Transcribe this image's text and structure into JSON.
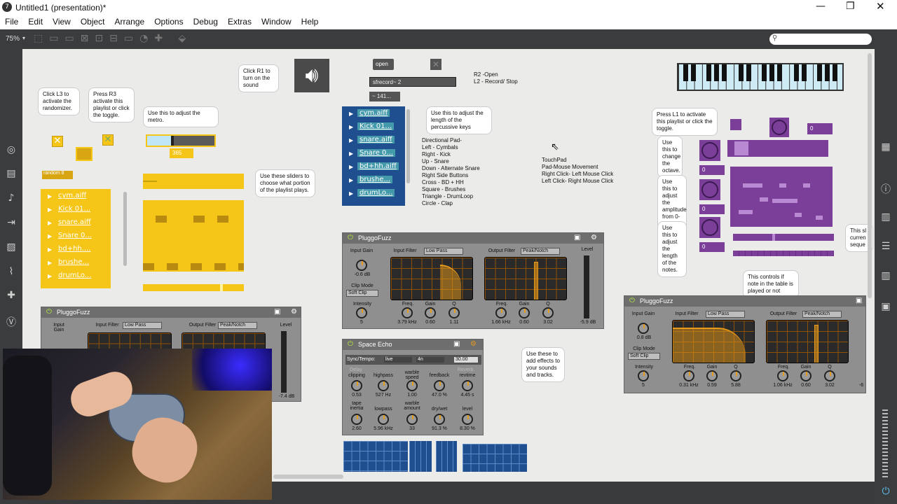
{
  "window": {
    "title": "Untitled1 (presentation)*"
  },
  "menu": [
    "File",
    "Edit",
    "View",
    "Object",
    "Arrange",
    "Options",
    "Debug",
    "Extras",
    "Window",
    "Help"
  ],
  "toolbar": {
    "zoom": "75%"
  },
  "bubbles": {
    "l3": "Click L3 to activate the randomizer.",
    "r3": "Press R3 activate this playlist or click the toggle.",
    "metro": "Use this to adjust the metro.",
    "r1": "Click R1 to turn on the sound",
    "sliders": "Use these sliders to choose what portion of the playlist plays.",
    "length": "Use this to adjust the length of the percussive keys",
    "l1": "Press L1 to activate this playlist or click the toggle.",
    "octave": "Use this to change the octave.",
    "amp": "Use this to adjust the amplitude from 0-127.",
    "notelen": "Use this to adjust the length of the notes.",
    "controls": "This controls if note in the table is played or not",
    "effects": "Use these to add effects to your sounds and tracks.",
    "right_cut": "This sl curren seque"
  },
  "buttons": {
    "open": "open",
    "random": "random 8"
  },
  "numbers": {
    "metro": "365",
    "tempo": "~ 141...",
    "purple1": "0",
    "purple2": "0",
    "purple3": "0",
    "purple4": "0"
  },
  "sfrecord": "sfrecord~ 2",
  "recinfo": [
    "R2 -Open",
    "L2 - Record/ Stop"
  ],
  "dpad": [
    "Directional Pad-",
    "Left - Cymbals",
    "Right - Kick",
    "Up - Snare",
    "Down - Alternate Snare",
    "",
    "Right Side Buttons",
    "Cross - BD + HH",
    "Square - Brushes",
    "Triangle - DrumLoop",
    "Circle - Clap"
  ],
  "touchpad": [
    "TouchPad",
    "Pad-Mouse Movement",
    "Right Click- Left Mouse Click",
    "Left Click- Right Mouse Click"
  ],
  "playlist_left": [
    "cym.aiff",
    "Kick 01...",
    "snare.aiff",
    "Snare 0...",
    "bd+hh....",
    "brushe...",
    "drumLo..."
  ],
  "playlist_mid": [
    "cym.aiff",
    "Kick 01...",
    "snare.aiff",
    "Snare 0...",
    "bd+hh.aiff",
    "brushe...",
    "drumLo..."
  ],
  "fuzz_mid": {
    "title": "PluggoFuzz",
    "input_gain_label": "Input Gain",
    "input_gain": "-0.6 dB",
    "clip_mode_label": "Clip Mode",
    "clip_mode": "Soft Clip",
    "intensity_label": "Intensity",
    "intensity": "5",
    "input_filter_label": "Input Filter",
    "input_filter": "Low Pass",
    "output_filter_label": "Output Filter",
    "output_filter": "Peak/Notch",
    "level_label": "Level",
    "level": "-5.9 dB",
    "freq_label": "Freq.",
    "gain_label": "Gain",
    "q_label": "Q",
    "in_freq": "3.79 kHz",
    "in_gain": "0.60",
    "in_q": "1.11",
    "out_freq": "1.66 kHz",
    "out_gain": "0.60",
    "out_q": "3.02"
  },
  "fuzz_left": {
    "title": "PluggoFuzz",
    "input_gain_label": "Input Gain",
    "input_filter_label": "Input Filter",
    "input_filter": "Low Pass",
    "output_filter_label": "Output Filter",
    "output_filter": "Peak/Notch",
    "level_label": "Level",
    "level": "-7.4 dB"
  },
  "fuzz_right": {
    "title": "PluggoFuzz",
    "input_gain_label": "Input Gain",
    "input_gain": "0.8 dB",
    "clip_mode_label": "Clip Mode",
    "clip_mode": "Soft Clip",
    "intensity_label": "Intensity",
    "intensity": "5",
    "input_filter_label": "Input Filter",
    "input_filter": "Low Pass",
    "output_filter_label": "Output Filter",
    "output_filter": "Peak/Notch",
    "freq_label": "Freq.",
    "gain_label": "Gain",
    "q_label": "Q",
    "in_freq": "0.31 kHz",
    "in_gain": "0.59",
    "in_q": "5.88",
    "out_freq": "1.06 kHz",
    "out_gain": "0.60",
    "out_q": "3.02",
    "cut": "-6"
  },
  "echo": {
    "title": "Space Echo",
    "sync_label": "Sync/Tempo:",
    "sync": "live",
    "div": "4n",
    "tempo": "30.00",
    "delay": "Delay",
    "reverb": "Reverb",
    "clipping_label": "clipping",
    "clipping": "0.53",
    "highpass_label": "highpass",
    "highpass": "527 Hz",
    "wspeed_label": "warble speed",
    "wspeed": "1.00",
    "feedback_label": "feedback",
    "feedback": "47.0 %",
    "revtime_label": "revtime",
    "revtime": "4.45 s",
    "inertia_label": "tape inertia",
    "inertia": "2.60",
    "lowpass_label": "lowpass",
    "lowpass": "5.96 kHz",
    "wamount_label": "warble amount",
    "wamount": "33",
    "drywet_label": "dry/wet",
    "drywet": "91.3 %",
    "level_label": "level",
    "level": "8.30 %"
  },
  "colors": {
    "accent_yellow": "#f5c518",
    "purple": "#7b3f99",
    "playlist_blue": "#1f4f8f"
  }
}
